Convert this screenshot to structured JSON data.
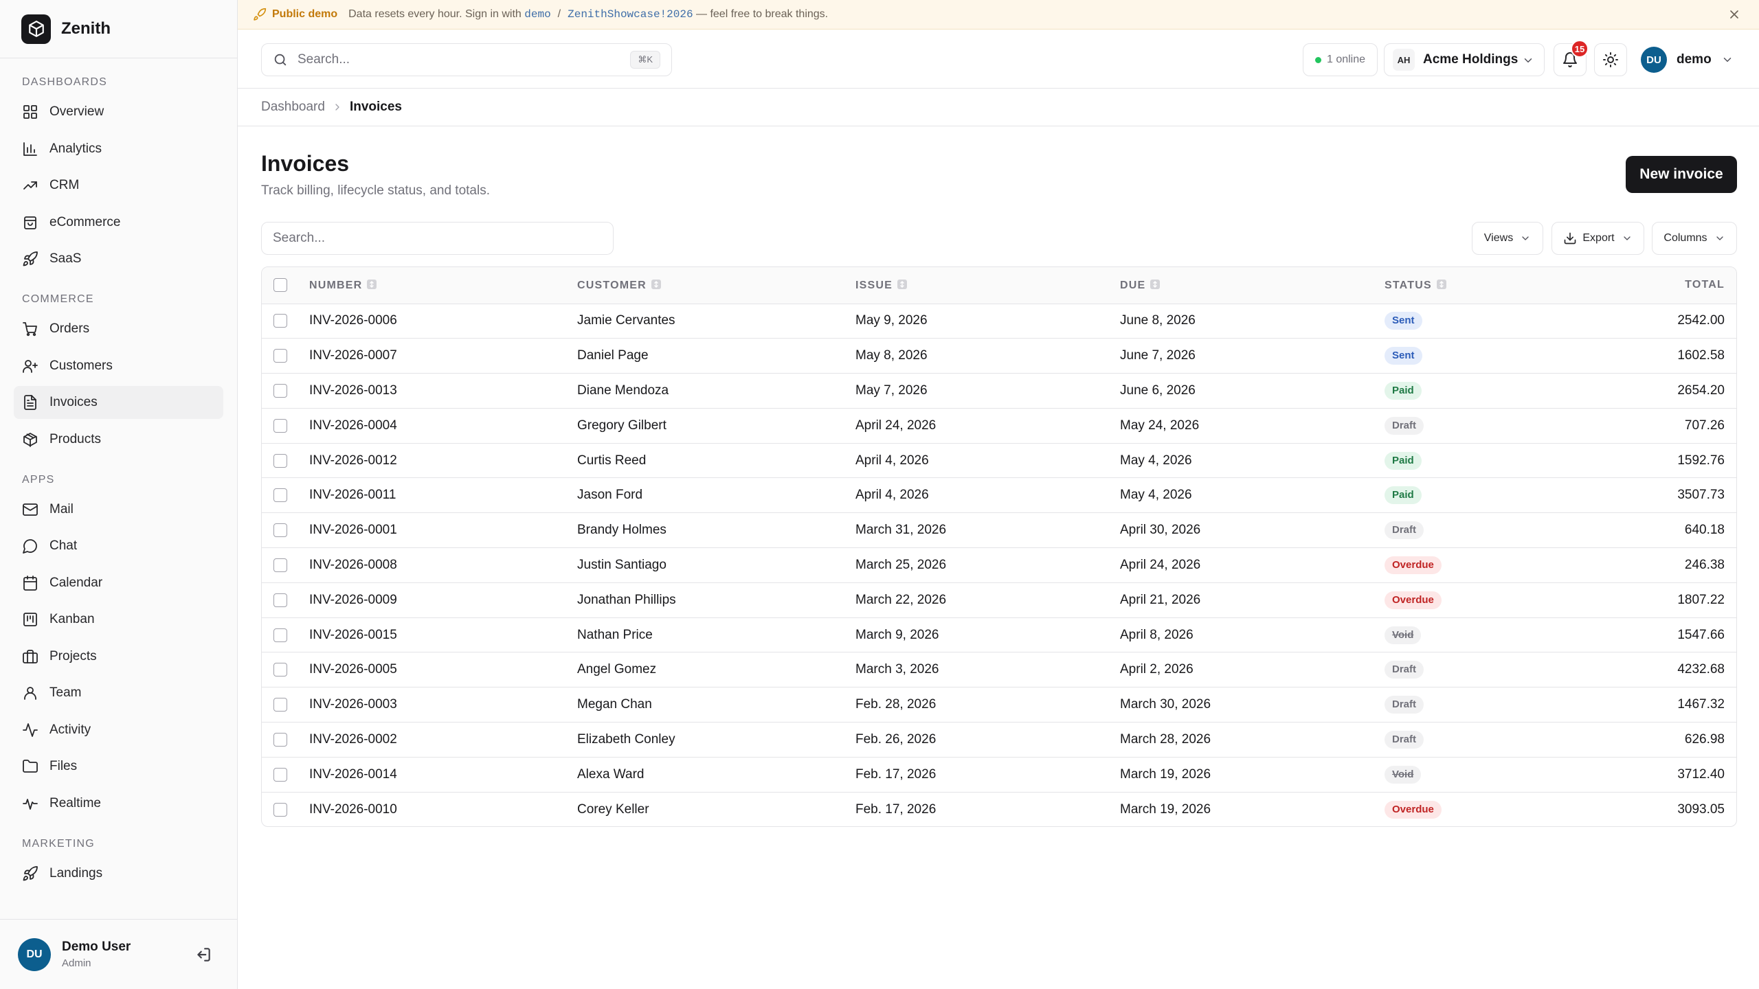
{
  "app": {
    "name": "Zenith"
  },
  "banner": {
    "label": "Public demo",
    "text_before": "Data resets every hour. Sign in with",
    "username": "demo",
    "separator": "/",
    "password": "ZenithShowcase!2026",
    "text_after": "— feel free to break things."
  },
  "sidebar": {
    "sections": [
      {
        "label": "DASHBOARDS",
        "items": [
          {
            "label": "Overview",
            "icon": "layout-grid-icon"
          },
          {
            "label": "Analytics",
            "icon": "bar-chart-icon"
          },
          {
            "label": "CRM",
            "icon": "trending-up-icon"
          },
          {
            "label": "eCommerce",
            "icon": "shopping-bag-icon"
          },
          {
            "label": "SaaS",
            "icon": "rocket-icon"
          }
        ]
      },
      {
        "label": "COMMERCE",
        "items": [
          {
            "label": "Orders",
            "icon": "cart-icon"
          },
          {
            "label": "Customers",
            "icon": "user-plus-icon"
          },
          {
            "label": "Invoices",
            "icon": "file-text-icon",
            "active": true
          },
          {
            "label": "Products",
            "icon": "package-icon"
          }
        ]
      },
      {
        "label": "APPS",
        "items": [
          {
            "label": "Mail",
            "icon": "mail-icon"
          },
          {
            "label": "Chat",
            "icon": "message-circle-icon"
          },
          {
            "label": "Calendar",
            "icon": "calendar-icon"
          },
          {
            "label": "Kanban",
            "icon": "kanban-icon"
          },
          {
            "label": "Projects",
            "icon": "briefcase-icon"
          },
          {
            "label": "Team",
            "icon": "user-icon"
          },
          {
            "label": "Activity",
            "icon": "activity-icon"
          },
          {
            "label": "Files",
            "icon": "folder-icon"
          },
          {
            "label": "Realtime",
            "icon": "pulse-icon"
          }
        ]
      },
      {
        "label": "MARKETING",
        "items": [
          {
            "label": "Landings",
            "icon": "rocket-icon"
          }
        ]
      }
    ],
    "user": {
      "initials": "DU",
      "name": "Demo User",
      "role": "Admin"
    }
  },
  "topbar": {
    "search_placeholder": "Search...",
    "search_shortcut": "⌘K",
    "online": "1 online",
    "org_initials": "AH",
    "org_name": "Acme Holdings",
    "notifications": "15",
    "user_initials": "DU",
    "user_name": "demo"
  },
  "breadcrumb": {
    "parent": "Dashboard",
    "current": "Invoices"
  },
  "page": {
    "title": "Invoices",
    "subtitle": "Track billing, lifecycle status, and totals.",
    "new_button": "New invoice"
  },
  "toolbar": {
    "search_placeholder": "Search...",
    "views": "Views",
    "export": "Export",
    "columns": "Columns"
  },
  "table": {
    "columns": [
      "NUMBER",
      "CUSTOMER",
      "ISSUE",
      "DUE",
      "STATUS",
      "TOTAL"
    ],
    "rows": [
      {
        "number": "INV-2026-0006",
        "customer": "Jamie Cervantes",
        "issue": "May 9, 2026",
        "due": "June 8, 2026",
        "status": "Sent",
        "total": "2542.00"
      },
      {
        "number": "INV-2026-0007",
        "customer": "Daniel Page",
        "issue": "May 8, 2026",
        "due": "June 7, 2026",
        "status": "Sent",
        "total": "1602.58"
      },
      {
        "number": "INV-2026-0013",
        "customer": "Diane Mendoza",
        "issue": "May 7, 2026",
        "due": "June 6, 2026",
        "status": "Paid",
        "total": "2654.20"
      },
      {
        "number": "INV-2026-0004",
        "customer": "Gregory Gilbert",
        "issue": "April 24, 2026",
        "due": "May 24, 2026",
        "status": "Draft",
        "total": "707.26"
      },
      {
        "number": "INV-2026-0012",
        "customer": "Curtis Reed",
        "issue": "April 4, 2026",
        "due": "May 4, 2026",
        "status": "Paid",
        "total": "1592.76"
      },
      {
        "number": "INV-2026-0011",
        "customer": "Jason Ford",
        "issue": "April 4, 2026",
        "due": "May 4, 2026",
        "status": "Paid",
        "total": "3507.73"
      },
      {
        "number": "INV-2026-0001",
        "customer": "Brandy Holmes",
        "issue": "March 31, 2026",
        "due": "April 30, 2026",
        "status": "Draft",
        "total": "640.18"
      },
      {
        "number": "INV-2026-0008",
        "customer": "Justin Santiago",
        "issue": "March 25, 2026",
        "due": "April 24, 2026",
        "status": "Overdue",
        "total": "246.38"
      },
      {
        "number": "INV-2026-0009",
        "customer": "Jonathan Phillips",
        "issue": "March 22, 2026",
        "due": "April 21, 2026",
        "status": "Overdue",
        "total": "1807.22"
      },
      {
        "number": "INV-2026-0015",
        "customer": "Nathan Price",
        "issue": "March 9, 2026",
        "due": "April 8, 2026",
        "status": "Void",
        "total": "1547.66"
      },
      {
        "number": "INV-2026-0005",
        "customer": "Angel Gomez",
        "issue": "March 3, 2026",
        "due": "April 2, 2026",
        "status": "Draft",
        "total": "4232.68"
      },
      {
        "number": "INV-2026-0003",
        "customer": "Megan Chan",
        "issue": "Feb. 28, 2026",
        "due": "March 30, 2026",
        "status": "Draft",
        "total": "1467.32"
      },
      {
        "number": "INV-2026-0002",
        "customer": "Elizabeth Conley",
        "issue": "Feb. 26, 2026",
        "due": "March 28, 2026",
        "status": "Draft",
        "total": "626.98"
      },
      {
        "number": "INV-2026-0014",
        "customer": "Alexa Ward",
        "issue": "Feb. 17, 2026",
        "due": "March 19, 2026",
        "status": "Void",
        "total": "3712.40"
      },
      {
        "number": "INV-2026-0010",
        "customer": "Corey Keller",
        "issue": "Feb. 17, 2026",
        "due": "March 19, 2026",
        "status": "Overdue",
        "total": "3093.05"
      }
    ]
  },
  "colors": {
    "primary": "#18181b",
    "sidebar_bg": "#fafafa",
    "banner_bg": "#fef7ea",
    "banner_accent": "#c2790a",
    "avatar": "#0c5e8e",
    "notification": "#dc2626",
    "online": "#22c55e",
    "status_sent": "#2c5cb8",
    "status_paid": "#1f7a45",
    "status_draft": "#71717a",
    "status_overdue": "#c02424"
  }
}
